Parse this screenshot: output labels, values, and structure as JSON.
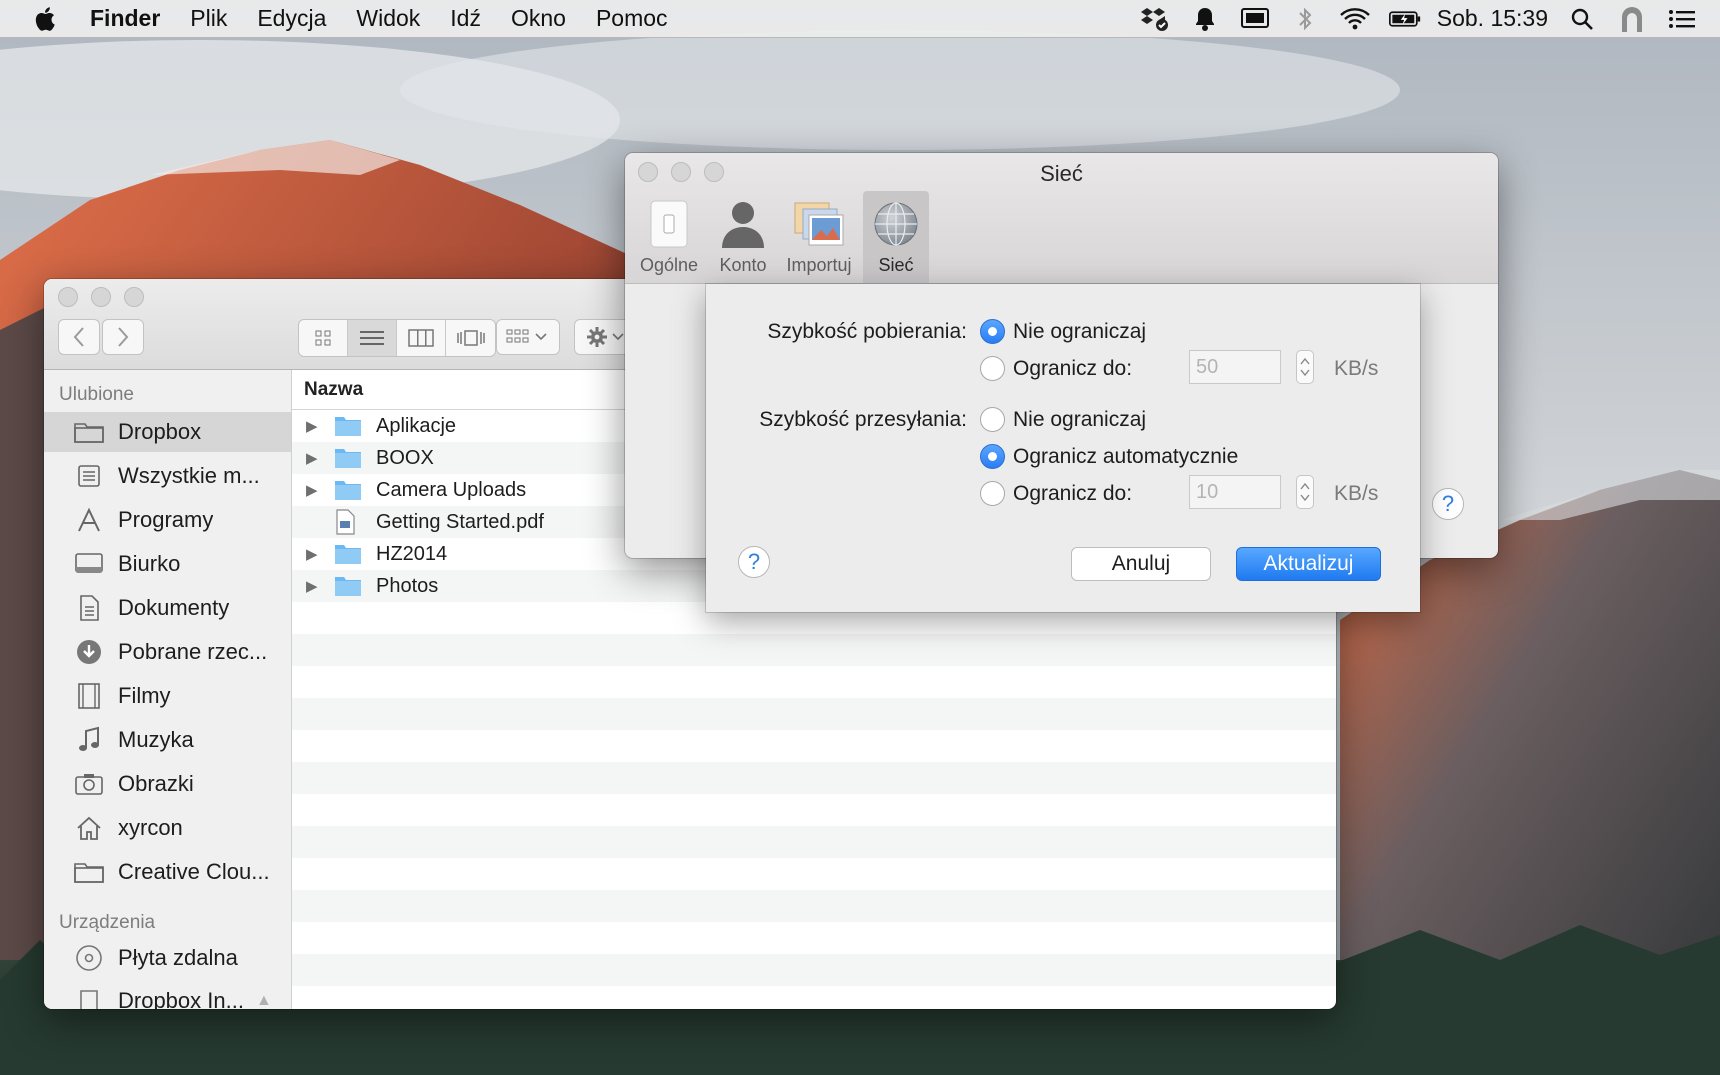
{
  "menubar": {
    "app": "Finder",
    "items": [
      "Plik",
      "Edycja",
      "Widok",
      "Idź",
      "Okno",
      "Pomoc"
    ],
    "clock": "Sob. 15:39"
  },
  "finder": {
    "sidebar": {
      "favorites_header": "Ulubione",
      "favorites": [
        {
          "label": "Dropbox",
          "icon": "folder-icon"
        },
        {
          "label": "Wszystkie m...",
          "icon": "all-files-icon"
        },
        {
          "label": "Programy",
          "icon": "applications-icon"
        },
        {
          "label": "Biurko",
          "icon": "desktop-icon"
        },
        {
          "label": "Dokumenty",
          "icon": "documents-icon"
        },
        {
          "label": "Pobrane rzec...",
          "icon": "downloads-icon"
        },
        {
          "label": "Filmy",
          "icon": "movies-icon"
        },
        {
          "label": "Muzyka",
          "icon": "music-icon"
        },
        {
          "label": "Obrazki",
          "icon": "pictures-icon"
        },
        {
          "label": "xyrcon",
          "icon": "home-icon"
        },
        {
          "label": "Creative Clou...",
          "icon": "folder-icon"
        }
      ],
      "devices_header": "Urządzenia",
      "devices": [
        {
          "label": "Płyta zdalna",
          "icon": "remote-disc-icon"
        },
        {
          "label": "Dropbox In...",
          "icon": "disk-icon"
        }
      ]
    },
    "column_header": "Nazwa",
    "files": [
      {
        "name": "Aplikacje",
        "type": "folder"
      },
      {
        "name": "BOOX",
        "type": "folder"
      },
      {
        "name": "Camera Uploads",
        "type": "folder"
      },
      {
        "name": "Getting Started.pdf",
        "type": "pdf"
      },
      {
        "name": "HZ2014",
        "type": "folder"
      },
      {
        "name": "Photos",
        "type": "folder"
      }
    ]
  },
  "prefs": {
    "title": "Sieć",
    "tabs": [
      "Ogólne",
      "Konto",
      "Importuj",
      "Sieć"
    ],
    "active_tab": "Sieć"
  },
  "sheet": {
    "download_label": "Szybkość pobierania:",
    "download_options": [
      "Nie ograniczaj",
      "Ogranicz do:"
    ],
    "download_value": "50",
    "upload_label": "Szybkość przesyłania:",
    "upload_options": [
      "Nie ograniczaj",
      "Ogranicz automatycznie",
      "Ogranicz do:"
    ],
    "upload_value": "10",
    "unit": "KB/s",
    "cancel": "Anuluj",
    "update": "Aktualizuj",
    "help": "?"
  },
  "colors": {
    "accent": "#2a7df3",
    "selection": "#d6d6d6",
    "folder": "#6cb8f0"
  }
}
